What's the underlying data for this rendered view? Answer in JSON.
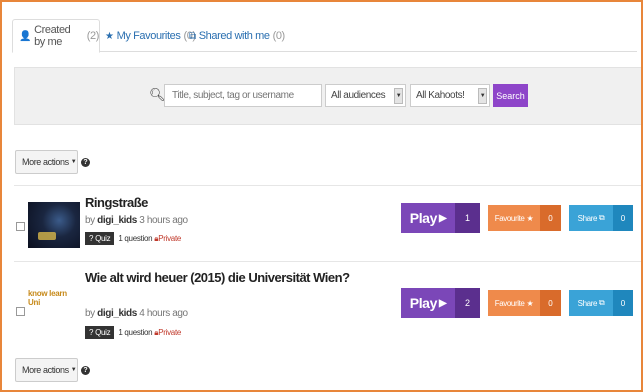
{
  "tabs": [
    {
      "label": "Created by me",
      "count": "(2)"
    },
    {
      "label": "My Favourites",
      "count": "(0)"
    },
    {
      "label": "Shared with me",
      "count": "(0)"
    }
  ],
  "search": {
    "placeholder": "Title, subject, tag or username",
    "audience_value": "All audiences",
    "kahoots_value": "All Kahoots!",
    "button_label": "Search"
  },
  "more_actions_label": "More actions",
  "help_label": "?",
  "kahoots": [
    {
      "title": "Ringstraße",
      "by": "by",
      "username": "digi_kids",
      "time": "3 hours ago",
      "type": "Quiz",
      "questions": "1 question",
      "visibility": "Private",
      "play_label": "Play",
      "plays": "1",
      "favourite_label": "Favourite",
      "favourites": "0",
      "share_label": "Share",
      "shares": "0"
    },
    {
      "title": "Wie alt wird heuer (2015) die Universität Wien?",
      "by": "by",
      "username": "digi_kids",
      "time": "4 hours ago",
      "type": "Quiz",
      "questions": "1 question",
      "visibility": "Private",
      "play_label": "Play",
      "plays": "2",
      "favourite_label": "Favourite",
      "favourites": "0",
      "share_label": "Share",
      "shares": "0",
      "thumbnail_text": "know learn Uni"
    }
  ],
  "colors": {
    "frame": "#e8863a",
    "play": "#7b47b8",
    "favourite": "#ef8a4b",
    "share": "#3aa3d7",
    "search_button": "#8e45c9"
  }
}
